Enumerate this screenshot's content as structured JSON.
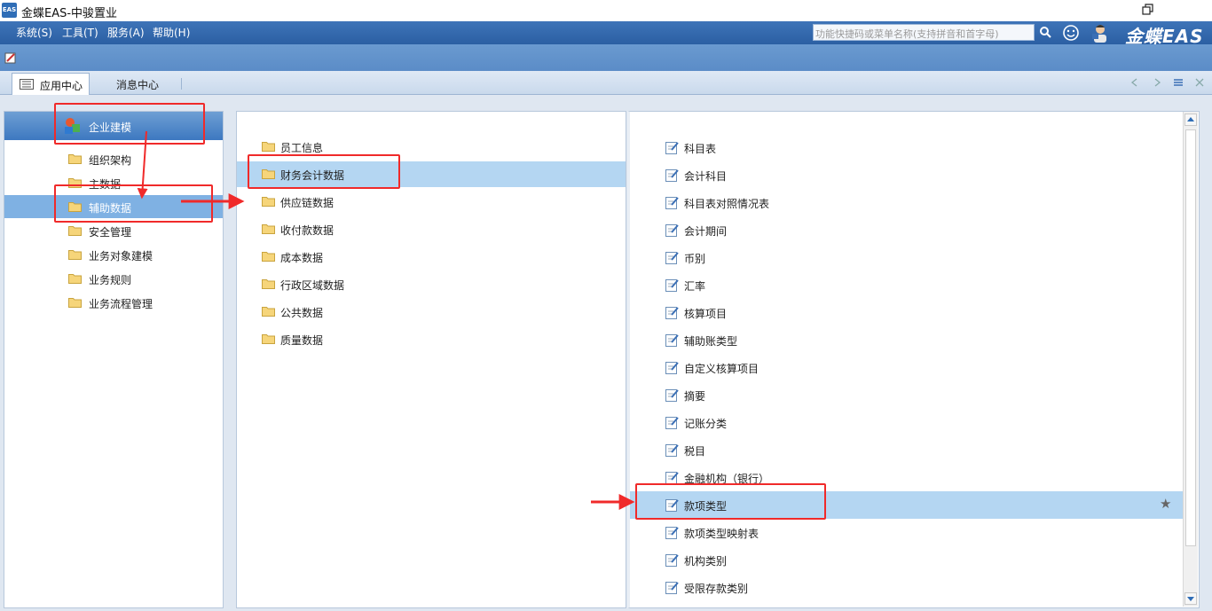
{
  "window": {
    "title": "金蝶EAS-中骏置业",
    "icon_text": "EAS"
  },
  "menubar": {
    "items": [
      "系统(S)",
      "工具(T)",
      "服务(A)",
      "帮助(H)"
    ],
    "search_placeholder": "功能快捷码或菜单名称(支持拼音和首字母)",
    "brand": "金蝶EAS"
  },
  "tabs": {
    "active": "应用中心",
    "other": "消息中心"
  },
  "left_panel": {
    "header": "企业建模",
    "items": [
      "组织架构",
      "主数据",
      "辅助数据",
      "安全管理",
      "业务对象建模",
      "业务规则",
      "业务流程管理"
    ],
    "selected_index": 2
  },
  "mid_panel": {
    "items": [
      "员工信息",
      "财务会计数据",
      "供应链数据",
      "收付款数据",
      "成本数据",
      "行政区域数据",
      "公共数据",
      "质量数据"
    ],
    "selected_index": 1
  },
  "right_panel": {
    "items": [
      "科目表",
      "会计科目",
      "科目表对照情况表",
      "会计期间",
      "币别",
      "汇率",
      "核算项目",
      "辅助账类型",
      "自定义核算项目",
      "摘要",
      "记账分类",
      "税目",
      "金融机构（银行）",
      "款项类型",
      "款项类型映射表",
      "机构类别",
      "受限存款类别"
    ],
    "selected_index": 13,
    "star": "★"
  },
  "colors": {
    "menubar": "#2b5fa3",
    "selection": "#b4d6f2",
    "annotation": "#f02a2a"
  },
  "icons": [
    "eas-app-icon",
    "search-icon",
    "smile-icon",
    "user-icon",
    "folder-icon",
    "document-edit-icon",
    "star-icon"
  ]
}
